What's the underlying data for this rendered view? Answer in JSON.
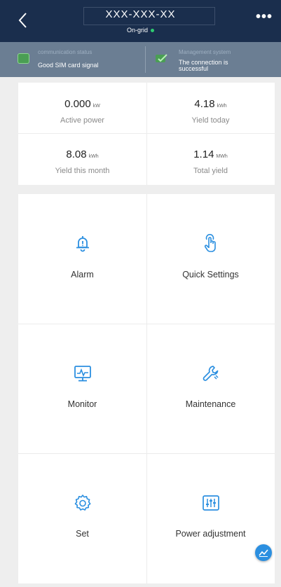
{
  "header": {
    "title": "XXX-XXX-XX",
    "subtitle": "On-grid",
    "more_label": "•••"
  },
  "status": {
    "communication": {
      "label": "communication status",
      "value": "Good SIM card signal"
    },
    "management": {
      "label": "Management system",
      "value_line1": "The connection is",
      "value_line2": "successful"
    }
  },
  "metrics": [
    {
      "value": "0.000",
      "unit": "kW",
      "label": "Active power"
    },
    {
      "value": "4.18",
      "unit": "kWh",
      "label": "Yield today"
    },
    {
      "value": "8.08",
      "unit": "kWh",
      "label": "Yield this month"
    },
    {
      "value": "1.14",
      "unit": "MWh",
      "label": "Total yield"
    }
  ],
  "tiles": [
    {
      "label": "Alarm",
      "icon": "alarm-bell-icon"
    },
    {
      "label": "Quick Settings",
      "icon": "hand-pointer-icon"
    },
    {
      "label": "Monitor",
      "icon": "monitor-icon"
    },
    {
      "label": "Maintenance",
      "icon": "wrench-icon"
    },
    {
      "label": "Set",
      "icon": "gear-icon"
    },
    {
      "label": "Power adjustment",
      "icon": "sliders-icon"
    }
  ],
  "colors": {
    "header_bg": "#1a2e4d",
    "status_bg": "#6b7e93",
    "accent": "#2b8fe0",
    "online": "#2ecc71"
  }
}
